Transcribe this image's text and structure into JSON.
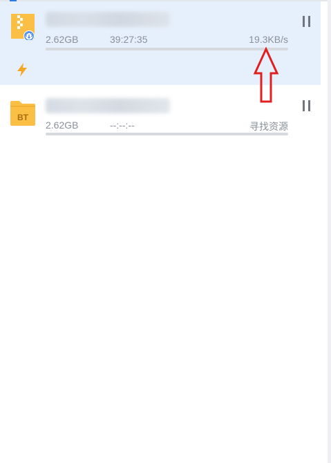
{
  "downloads": [
    {
      "size": "2.62GB",
      "time_remaining": "39:27:35",
      "speed": "19.3KB/s",
      "progress": 0,
      "status": "downloading",
      "icon": "cloud-zip-file-icon",
      "accelerate_icon": "lightning-icon",
      "pause_icon": "pause-icon"
    },
    {
      "size": "2.62GB",
      "time_remaining": "--:--:--",
      "speed": "寻找资源",
      "progress": 0,
      "status": "searching",
      "icon": "bt-folder-icon",
      "pause_icon": "pause-icon"
    }
  ],
  "annotation": {
    "type": "arrow",
    "color": "#e02020"
  },
  "colors": {
    "selected_bg": "#e6f0fc",
    "folder": "#fbbf45",
    "accent": "#2d7ae8"
  }
}
